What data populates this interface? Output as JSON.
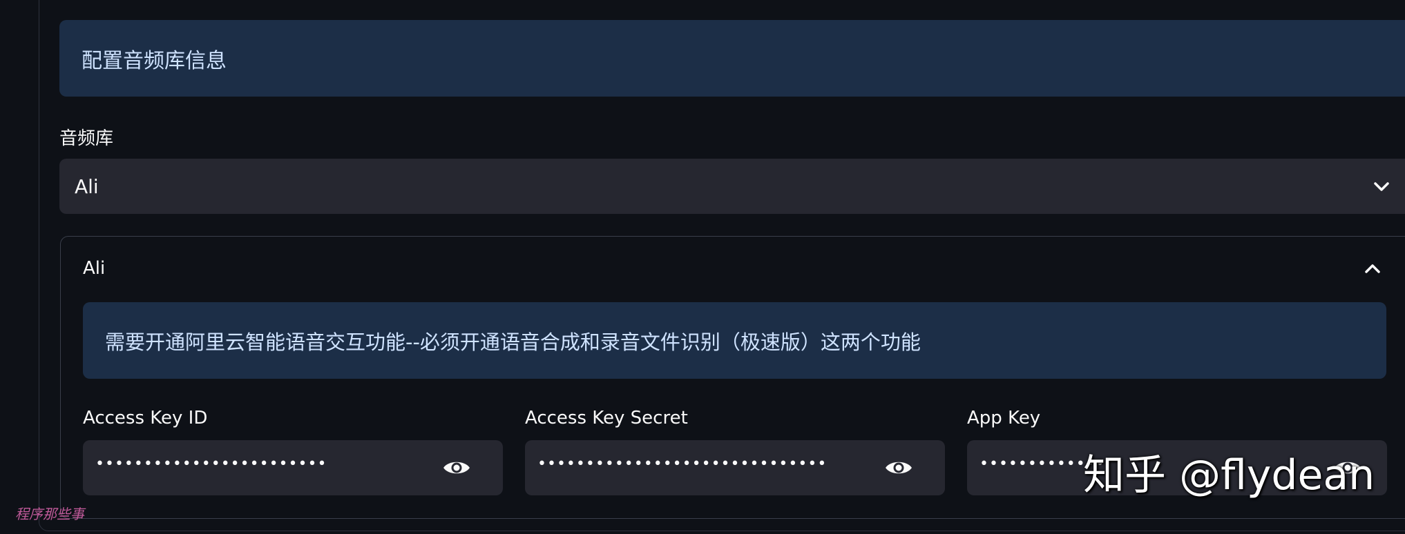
{
  "banner": {
    "text": "配置音频库信息"
  },
  "audio_library": {
    "label": "音频库",
    "selected": "Ali"
  },
  "expander": {
    "title": "Ali",
    "info": "需要开通阿里云智能语音交互功能--必须开通语音合成和录音文件识别（极速版）这两个功能"
  },
  "fields": [
    {
      "label": "Access Key ID",
      "masked_value": "••••••••••••••••••••••••"
    },
    {
      "label": "Access Key Secret",
      "masked_value": "••••••••••••••••••••••••••••••"
    },
    {
      "label": "App Key",
      "masked_value": "••••••••••••••••"
    }
  ],
  "watermark": {
    "text": "知乎 @flydean"
  },
  "stamp": {
    "text": "程序那些事"
  },
  "icons": {
    "select": "chevron-down-icon",
    "expander": "chevron-up-icon",
    "reveal": "eye-icon"
  },
  "colors": {
    "background": "#0e1117",
    "info_bg": "#1c2e47",
    "input_bg": "#262730",
    "info_text": "#cfe3ff"
  }
}
